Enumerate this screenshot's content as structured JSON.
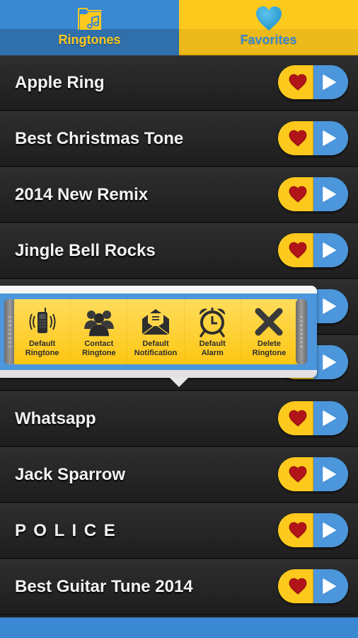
{
  "tabs": [
    {
      "label": "Ringtones",
      "icon": "music-folder-icon",
      "active": true
    },
    {
      "label": "Favorites",
      "icon": "heart-icon",
      "active": false
    }
  ],
  "ringtones": [
    {
      "title": "Apple Ring"
    },
    {
      "title": "Best Christmas Tone"
    },
    {
      "title": "2014 New Remix"
    },
    {
      "title": "Jingle Bell Rocks"
    },
    {
      "title": ""
    },
    {
      "title": ""
    },
    {
      "title": "Whatsapp"
    },
    {
      "title": "Jack Sparrow"
    },
    {
      "title": "P O L I C E"
    },
    {
      "title": "Best Guitar Tune 2014"
    }
  ],
  "row_actions": {
    "favorite_icon": "heart-icon",
    "play_icon": "play-icon"
  },
  "popup": {
    "actions": [
      {
        "label": "Default\nRingtone",
        "icon": "ringing-phone-icon"
      },
      {
        "label": "Contact\nRingtone",
        "icon": "contacts-group-icon"
      },
      {
        "label": "Default\nNotification",
        "icon": "envelope-icon"
      },
      {
        "label": "Default\nAlarm",
        "icon": "alarm-clock-icon"
      },
      {
        "label": "Delete\nRingtone",
        "icon": "delete-x-icon"
      }
    ]
  },
  "colors": {
    "blue": "#3a88d2",
    "yellow": "#fec91d",
    "heart_red": "#b3141a",
    "row_dark": "#1f1f1f"
  }
}
